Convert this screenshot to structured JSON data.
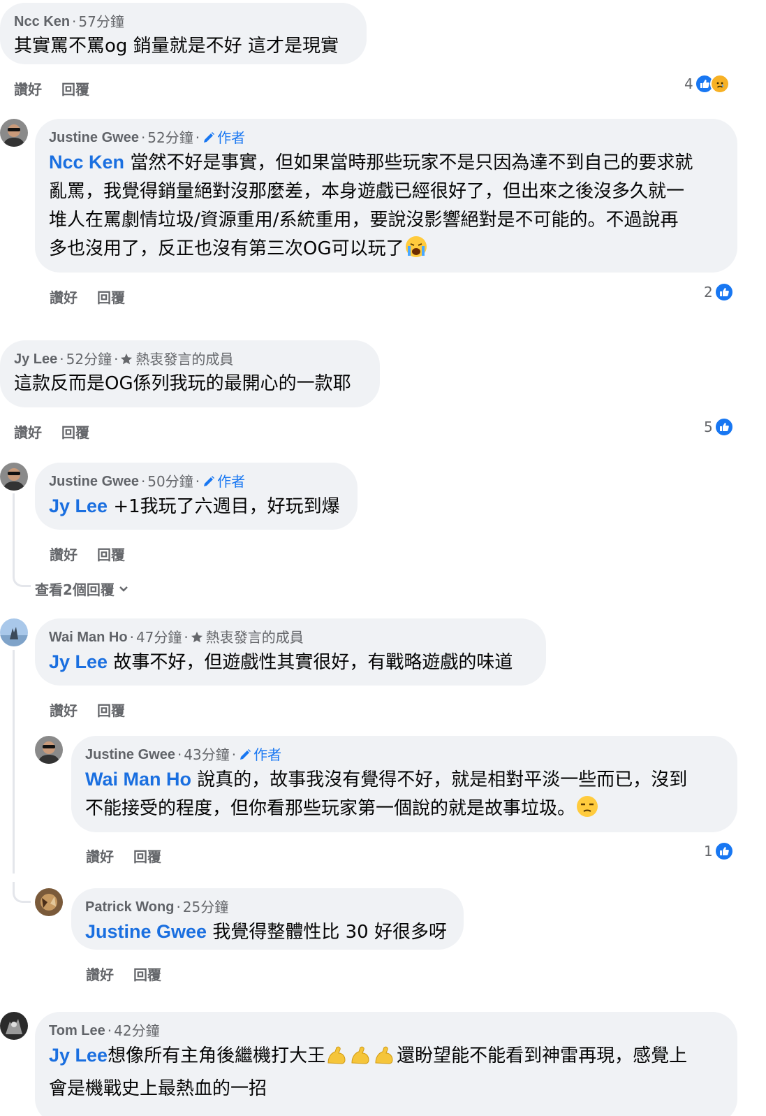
{
  "labels": {
    "like": "讚好",
    "reply": "回覆",
    "author": "作者",
    "top_fan": "熱衷發言的成員"
  },
  "colors": {
    "link": "#1877f2",
    "bubble": "#f0f2f5",
    "muted": "#65676b"
  },
  "comments": [
    {
      "name": "Ncc Ken",
      "time": "57分鐘",
      "text": "其實罵不罵og 銷量就是不好 這才是現實",
      "reactions": {
        "count": "4",
        "icons": [
          "like-icon",
          "sad-icon"
        ]
      }
    },
    {
      "name": "Justine Gwee",
      "time": "52分鐘",
      "badge": "作者",
      "mention": "Ncc Ken",
      "lines": [
        "當然不好是事實，但如果當時那些玩家不是只因為達不到自己的要求就",
        "亂罵，我覺得銷量絕對沒那麼差，本身遊戲已經很好了，但出來之後沒多久就一",
        "堆人在罵劇情垃圾/資源重用/系統重用，要說沒影響絕對是不可能的。不過說再",
        "多也沒用了，反正也沒有第三次OG可以玩了"
      ],
      "emoji": "crying-face-emoji",
      "reactions": {
        "count": "2",
        "icons": [
          "like-icon"
        ]
      }
    },
    {
      "name": "Jy Lee",
      "time": "52分鐘",
      "badge": "熱衷發言的成員",
      "text": "這款反而是OG係列我玩的最開心的一款耶",
      "reactions": {
        "count": "5",
        "icons": [
          "like-icon"
        ]
      }
    },
    {
      "name": "Justine Gwee",
      "time": "50分鐘",
      "badge": "作者",
      "mention": "Jy Lee",
      "text": "+1我玩了六週目，好玩到爆",
      "view_replies": "查看2個回覆"
    },
    {
      "name": "Wai Man Ho",
      "time": "47分鐘",
      "badge": "熱衷發言的成員",
      "mention": "Jy Lee",
      "text": "故事不好，但遊戲性其實很好，有戰略遊戲的味道"
    },
    {
      "name": "Justine Gwee",
      "time": "43分鐘",
      "badge": "作者",
      "mention": "Wai Man Ho",
      "lines": [
        "說真的，故事我沒有覺得不好，就是相對平淡一些而已，沒到",
        "不能接受的程度，但你看那些玩家第一個說的就是故事垃圾。"
      ],
      "emoji": "unamused-face-emoji",
      "reactions": {
        "count": "1",
        "icons": [
          "like-icon"
        ]
      }
    },
    {
      "name": "Patrick Wong",
      "time": "25分鐘",
      "mention": "Justine Gwee",
      "text": "我覺得整體性比 30 好很多呀"
    },
    {
      "name": "Tom Lee",
      "time": "42分鐘",
      "mention": "Jy Lee",
      "line1": "想像所有主角後繼機打大王",
      "emoji": "flexed-biceps-emoji",
      "line1b": "還盼望能不能看到神雷再現，感覺上",
      "line2": "會是機戰史上最熱血的一招"
    }
  ]
}
